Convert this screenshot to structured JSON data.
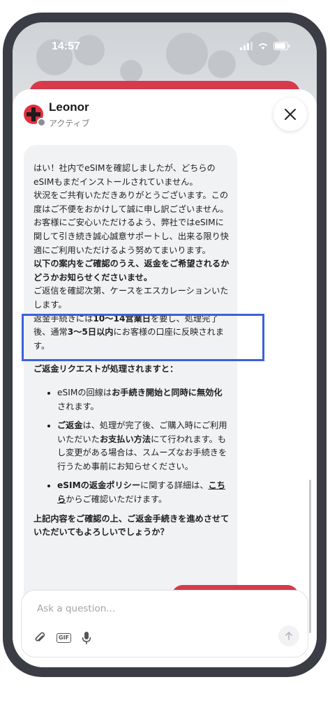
{
  "status": {
    "time": "14:57"
  },
  "header": {
    "agent_name": "Leonor",
    "agent_status": "アクティブ"
  },
  "message": {
    "p1": "はい！社内でeSIMを確認しましたが、どちらのeSIMもまだインストールされていません。",
    "p2": "状況をご共有いただきありがとうございます。この度はご不便をおかけして誠に申し訳ございません。お客様にご安心いただけるよう、弊社ではeSIMに関して引き続き誠心誠意サポートし、出来る限り快適にご利用いただけるよう努めてまいります。",
    "p3": "以下の案内をご確認のうえ、返金をご希望されるかどうかお知らせくださいませ。",
    "p4": "ご返信を確認次第、ケースをエスカレーションいたします。",
    "p5_a": "返金手続きには",
    "p5_b": "10～14営業日",
    "p5_c": "を要し、処理完了後、通常",
    "p5_d": "3～5日以内",
    "p5_e": "にお客様の口座に反映されます。",
    "list_title": "ご返金リクエストが処理されますと：",
    "b1_a": "eSIMの回線は",
    "b1_b": "お手続き開始と同時に無効化",
    "b1_c": "されます。",
    "b2_a": "ご返金",
    "b2_b": "は、処理が完了後、ご購入時にご利用いただいた",
    "b2_c": "お支払い方法",
    "b2_d": "にて行われます。もし変更がある場合は、スムーズなお手続きを行うため事前にお知らせください。",
    "b3_a": "eSIMの返金ポリシー",
    "b3_b": "に関する詳細は、",
    "b3_c": "こちら",
    "b3_d": "からご確認いただけます。",
    "closing": "上記内容をご確認の上、ご返金手続きを進めさせていただいてもよろしいでしょうか？"
  },
  "composer": {
    "placeholder": "Ask a question...",
    "gif_label": "GIF"
  },
  "colors": {
    "accent_red": "#d63a4b",
    "highlight_blue": "#3a62d8"
  }
}
